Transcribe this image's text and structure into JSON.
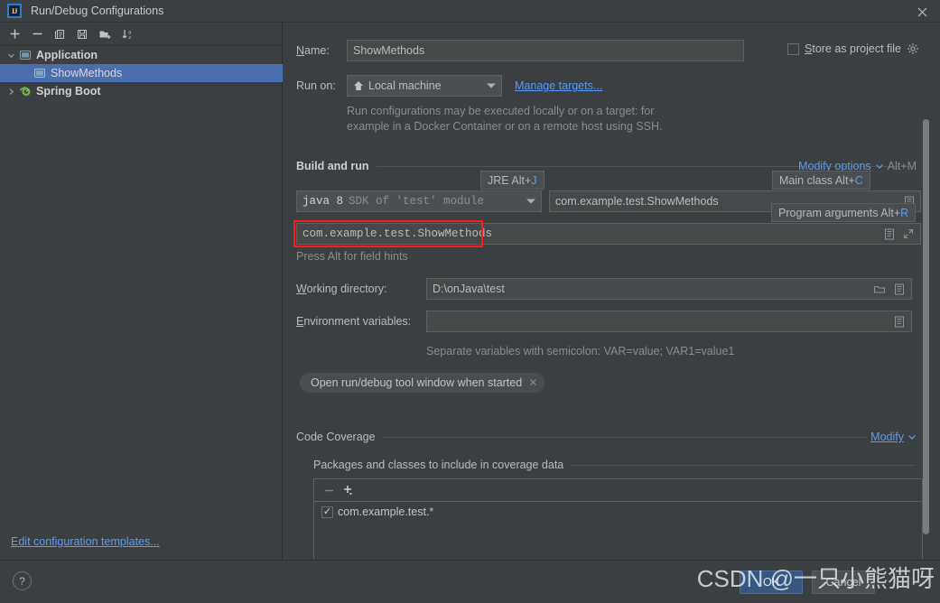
{
  "window": {
    "title": "Run/Debug Configurations",
    "logo_icon": "intellij-idea-logo-icon",
    "close_icon": "close-icon"
  },
  "sidebar": {
    "toolbar": [
      {
        "name": "add-configuration-button",
        "icon": "plus-icon",
        "label": "+"
      },
      {
        "name": "remove-configuration-button",
        "icon": "minus-icon",
        "label": "−"
      },
      {
        "name": "copy-configuration-button",
        "icon": "copy-icon",
        "label": ""
      },
      {
        "name": "save-configuration-button",
        "icon": "save-icon",
        "label": ""
      },
      {
        "name": "new-folder-button",
        "icon": "new-folder-icon",
        "label": ""
      },
      {
        "name": "sort-configurations-button",
        "icon": "sort-alphabetical-icon",
        "label": ""
      }
    ],
    "tree": [
      {
        "label": "Application",
        "type": "group",
        "expanded": true,
        "icon": "application-icon",
        "selected": false
      },
      {
        "label": "ShowMethods",
        "type": "child",
        "expanded": null,
        "icon": "run-configuration-icon",
        "selected": true
      },
      {
        "label": "Spring Boot",
        "type": "group",
        "expanded": false,
        "icon": "spring-boot-icon",
        "selected": false
      }
    ],
    "edit_templates_link": "Edit configuration templates..."
  },
  "form": {
    "name_label": "Name:",
    "name_value": "ShowMethods",
    "store_as_project_file_label": "Store as project file",
    "store_as_project_file_checked": false,
    "store_gear_icon": "gear-icon",
    "run_on_label": "Run on:",
    "run_on_value": "Local machine",
    "run_on_icon": "home-target-icon",
    "manage_targets_link": "Manage targets...",
    "run_on_hint_line1": "Run configurations may be executed locally or on a target: for",
    "run_on_hint_line2": "example in a Docker Container or on a remote host using SSH."
  },
  "build_and_run": {
    "section_title": "Build and run",
    "modify_options_link": "Modify options",
    "modify_options_shortcut": "Alt+M",
    "jre_combo_value_bold": "java 8",
    "jre_combo_value_rest": "SDK of 'test' module",
    "main_class_value": "com.example.test.ShowMethods",
    "program_arguments_value": "com.example.test.ShowMethods",
    "field_hint": "Press Alt for field hints",
    "tooltips": [
      {
        "name": "jre-tooltip",
        "text": "JRE Alt+",
        "key": "J"
      },
      {
        "name": "main-class-tooltip",
        "text": "Main class Alt+",
        "key": "C"
      },
      {
        "name": "program-arguments-tooltip",
        "text": "Program arguments Alt+",
        "key": "R"
      }
    ],
    "icons": {
      "main_class_browse": "list-icon",
      "program_args_browse": "list-icon",
      "program_args_expand": "expand-icon"
    }
  },
  "paths": {
    "working_directory_label": "Working directory:",
    "working_directory_value": "D:\\onJava\\test",
    "working_directory_folder_icon": "folder-icon",
    "working_directory_list_icon": "list-icon",
    "environment_variables_label": "Environment variables:",
    "environment_variables_value": "",
    "environment_variables_list_icon": "list-icon",
    "env_hint": "Separate variables with semicolon: VAR=value; VAR1=value1",
    "chip_label": "Open run/debug tool window when started",
    "chip_close_icon": "close-small-icon"
  },
  "code_coverage": {
    "section_title": "Code Coverage",
    "modify_link": "Modify",
    "packages_title": "Packages and classes to include in coverage data",
    "toolbar": [
      {
        "name": "remove-package-button",
        "icon": "minus-icon"
      },
      {
        "name": "add-package-button",
        "icon": "plus-dropdown-icon"
      }
    ],
    "items": [
      {
        "label": "com.example.test.*",
        "checked": true
      }
    ]
  },
  "bottom": {
    "help_label": "?",
    "help_icon": "help-icon",
    "ok_label": "OK",
    "cancel_label": "Cancel"
  },
  "watermark": {
    "text": "CSDN @一只小熊猫呀"
  },
  "colors": {
    "accent_link": "#589df6",
    "selection": "#4b6eaf",
    "ok_button": "#365880",
    "highlight_box": "#ff1a1a",
    "background": "#3c3f41"
  }
}
